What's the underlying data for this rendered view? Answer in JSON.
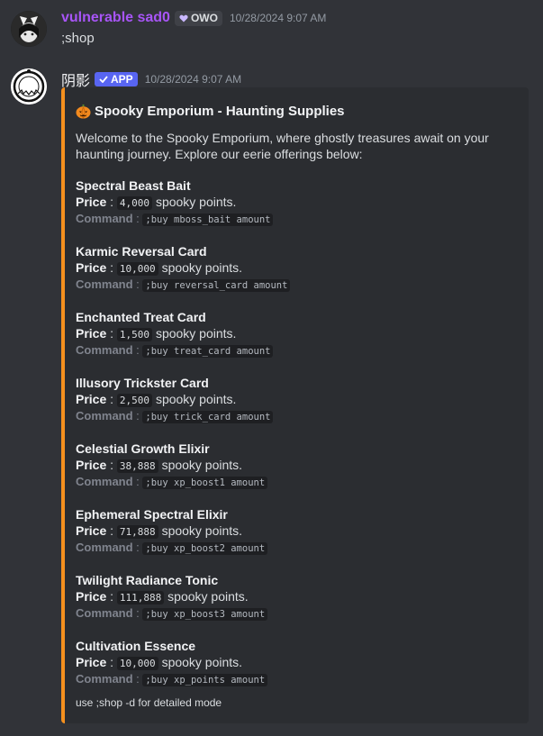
{
  "messages": [
    {
      "username": "vulnerable sad0",
      "tag": "OWO",
      "timestamp": "10/28/2024 9:07 AM",
      "content": ";shop"
    },
    {
      "username": "阴影",
      "tag": "APP",
      "timestamp": "10/28/2024 9:07 AM"
    }
  ],
  "embed": {
    "accent_color": "#f5901e",
    "title": "Spooky Emporium - Haunting Supplies",
    "title_icon": "pumpkin-icon",
    "description": "Welcome to the Spooky Emporium, where ghostly treasures await on your haunting journey. Explore our eerie offerings below:",
    "price_label": "Price",
    "command_label": "Command",
    "separator": " : ",
    "price_suffix": "spooky points.",
    "items": [
      {
        "name": "Spectral Beast Bait",
        "price": "4,000",
        "command": ";buy mboss_bait amount"
      },
      {
        "name": "Karmic Reversal Card",
        "price": "10,000",
        "command": ";buy reversal_card amount"
      },
      {
        "name": "Enchanted Treat Card",
        "price": "1,500",
        "command": ";buy treat_card amount"
      },
      {
        "name": "Illusory Trickster Card",
        "price": "2,500",
        "command": ";buy trick_card amount"
      },
      {
        "name": "Celestial Growth Elixir",
        "price": "38,888",
        "command": ";buy xp_boost1 amount"
      },
      {
        "name": "Ephemeral Spectral Elixir",
        "price": "71,888",
        "command": ";buy xp_boost2 amount"
      },
      {
        "name": "Twilight Radiance Tonic",
        "price": "111,888",
        "command": ";buy xp_boost3 amount"
      },
      {
        "name": "Cultivation Essence",
        "price": "10,000",
        "command": ";buy xp_points amount"
      }
    ],
    "footer": "use ;shop -d for detailed mode"
  }
}
